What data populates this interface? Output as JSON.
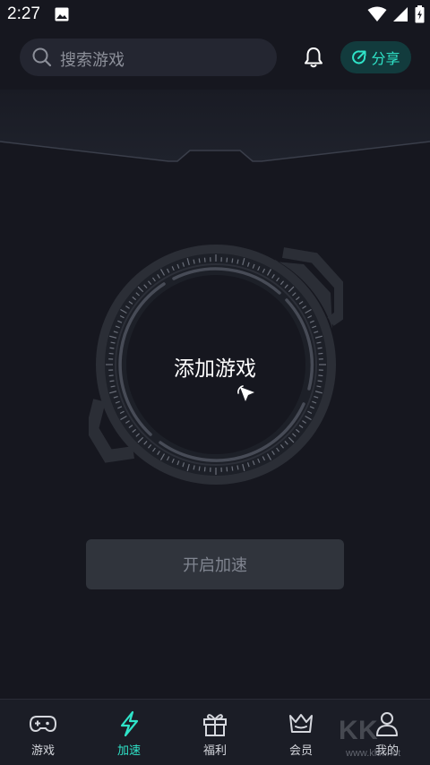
{
  "status_bar": {
    "time": "2:27"
  },
  "search": {
    "placeholder": "搜索游戏"
  },
  "header": {
    "share_label": "分享"
  },
  "dial": {
    "label": "添加游戏"
  },
  "start_button": {
    "label": "开启加速"
  },
  "bottom_nav": {
    "items": [
      {
        "label": "游戏",
        "icon": "gamepad-icon",
        "active": false
      },
      {
        "label": "加速",
        "icon": "lightning-icon",
        "active": true
      },
      {
        "label": "福利",
        "icon": "gift-icon",
        "active": false
      },
      {
        "label": "会员",
        "icon": "crown-icon",
        "active": false
      },
      {
        "label": "我的",
        "icon": "user-icon",
        "active": false
      }
    ]
  },
  "watermark": {
    "logo": "KK下载",
    "url": "www.kkx.net"
  },
  "colors": {
    "accent": "#2fe3c8",
    "background": "#16171f",
    "panel": "#242631"
  }
}
